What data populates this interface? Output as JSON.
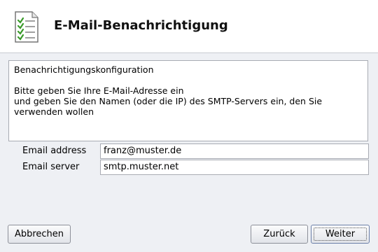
{
  "header": {
    "title": "E-Mail-Benachrichtigung",
    "icon": "checklist-icon"
  },
  "description": {
    "heading": "Benachrichtigungskonfiguration",
    "line1": "Bitte geben Sie Ihre E-Mail-Adresse ein",
    "line2": "und geben Sie den Namen (oder die IP) des SMTP-Servers ein, den Sie verwenden wollen"
  },
  "form": {
    "email_label": "Email address",
    "email_value": "franz@muster.de",
    "server_label": "Email server",
    "server_value": "smtp.muster.net"
  },
  "buttons": {
    "cancel": "Abbrechen",
    "back": "Zurück",
    "next": "Weiter"
  },
  "colors": {
    "background": "#eef0f4",
    "header_background": "#ffffff",
    "check_green": "#3a9a2a"
  }
}
